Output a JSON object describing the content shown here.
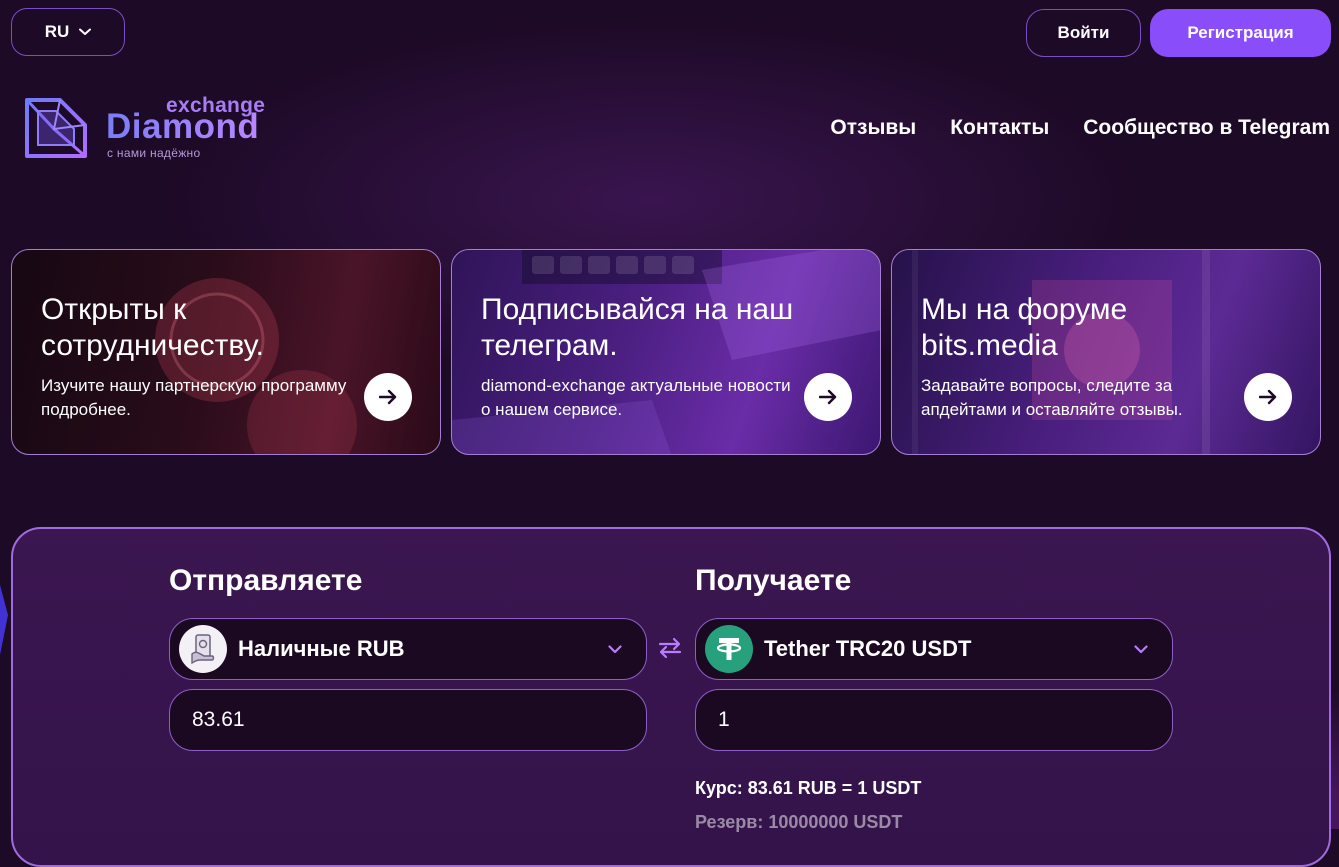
{
  "header": {
    "language": "RU",
    "login_label": "Войти",
    "register_label": "Регистрация"
  },
  "logo": {
    "small_text": "exchange",
    "main_text": "Diamond",
    "tagline": "с нами надёжно"
  },
  "nav": {
    "items": [
      {
        "label": "Отзывы"
      },
      {
        "label": "Контакты"
      },
      {
        "label": "Сообщество в Telegram"
      }
    ]
  },
  "cards": [
    {
      "title": "Открыты к сотрудничеству.",
      "text": "Изучите нашу партнерскую программу подробнее.",
      "icon": "arrow-right-icon"
    },
    {
      "title": "Подписывайся на наш телеграм.",
      "text": "diamond-exchange актуальные новости о нашем сервисе.",
      "icon": "arrow-right-icon"
    },
    {
      "title": "Мы на форуме bits.media",
      "text": "Задавайте вопросы, следите за апдейтами и оставляйте отзывы.",
      "icon": "arrow-right-icon"
    }
  ],
  "exchange": {
    "send": {
      "heading": "Отправляете",
      "currency": "Наличные RUB",
      "currency_icon": "cash-hand-icon",
      "amount": "83.61"
    },
    "receive": {
      "heading": "Получаете",
      "currency": "Tether TRC20 USDT",
      "currency_icon": "tether-icon",
      "amount": "1"
    },
    "rate": "Курс: 83.61 RUB = 1 USDT",
    "reserve": "Резерв: 10000000 USDT"
  },
  "colors": {
    "background": "#1d0a26",
    "accent": "#8a4dfa",
    "border": "#7b4fc4",
    "tether_green": "#26a17b"
  }
}
